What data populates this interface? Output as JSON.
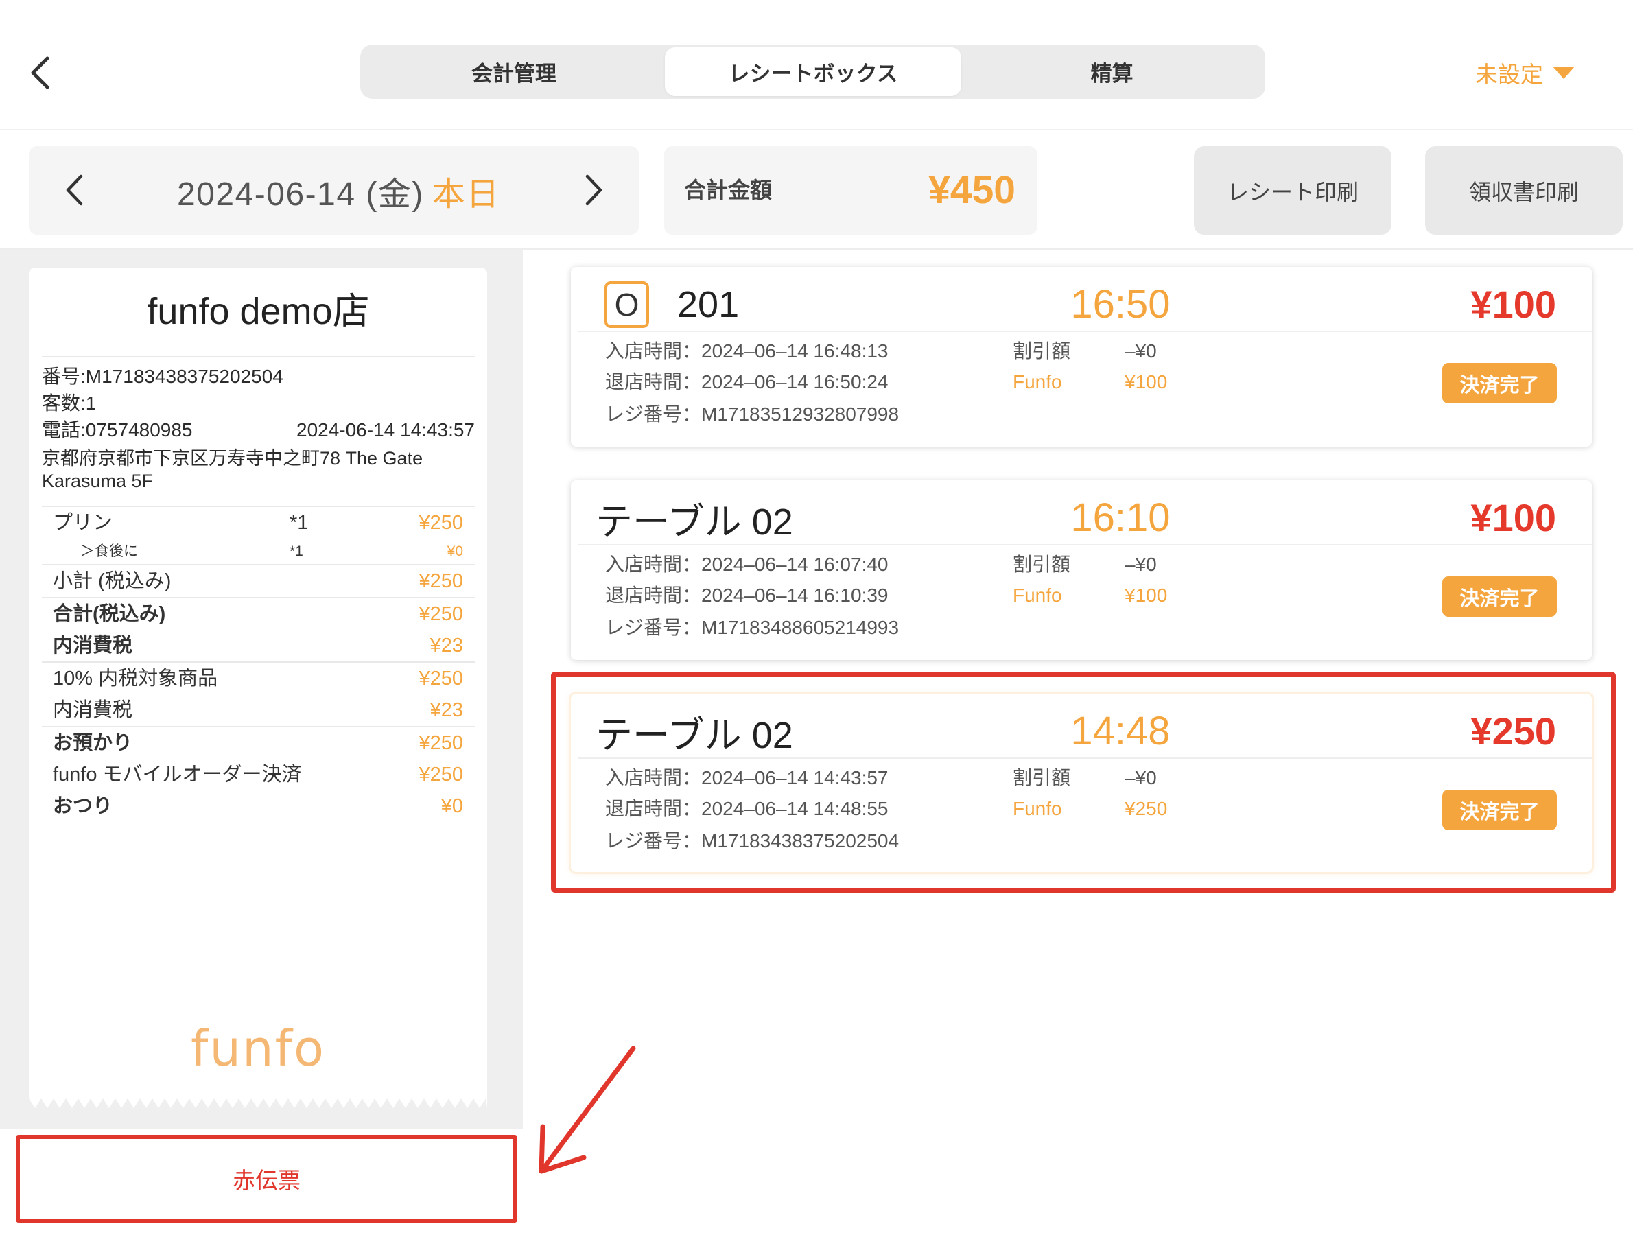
{
  "colors": {
    "accent_orange": "#f5a53d",
    "price_red": "#e5392c",
    "annotation_red": "#e1362c",
    "panel_gray": "#efefef"
  },
  "header": {
    "back_icon": "chevron-left-icon",
    "tabs": [
      {
        "label": "会計管理",
        "active": false
      },
      {
        "label": "レシートボックス",
        "active": true
      },
      {
        "label": "精算",
        "active": false
      }
    ],
    "status_label": "未設定",
    "status_icon": "caret-down-icon"
  },
  "toolbar": {
    "prev_icon": "chevron-left-icon",
    "next_icon": "chevron-right-icon",
    "date": "2024-06-14 (金)",
    "today_label": "本日",
    "total_label": "合計金額",
    "total_value": "¥450",
    "print_receipt_label": "レシート印刷",
    "print_invoice_label": "領収書印刷"
  },
  "receipt": {
    "store_name": "funfo demo店",
    "number": "番号:M17183438375202504",
    "guests": "客数:1",
    "phone": "電話:0757480985",
    "datetime": "2024-06-14 14:43:57",
    "address": [
      "京都府京都市下京区万寿寺中之町78 The Gate",
      "Karasuma 5F"
    ],
    "items": [
      {
        "name": "プリン",
        "qty": "*1",
        "price": "¥250",
        "sub": false
      },
      {
        "name": "＞食後に",
        "qty": "*1",
        "price": "¥0",
        "sub": true
      }
    ],
    "summary_groups": [
      [
        {
          "label": "小計 (税込み)",
          "value": "¥250",
          "strong": false
        }
      ],
      [
        {
          "label": "合計(税込み)",
          "value": "¥250",
          "strong": true
        },
        {
          "label": "内消費税",
          "value": "¥23",
          "strong": true
        }
      ],
      [
        {
          "label": "10% 内税対象商品",
          "value": "¥250",
          "strong": false
        },
        {
          "label": "内消費税",
          "value": "¥23",
          "strong": false
        }
      ],
      [
        {
          "label": "お預かり",
          "value": "¥250",
          "strong": true
        },
        {
          "label": "funfo モバイルオーダー決済",
          "value": "¥250",
          "strong": false
        },
        {
          "label": "おつり",
          "value": "¥0",
          "strong": true
        }
      ]
    ],
    "logo_text": "funfo"
  },
  "red_slip_label": "赤伝票",
  "orders": [
    {
      "icon_letter": "O",
      "title": "201",
      "time": "16:50",
      "amount": "¥100",
      "entry_label": "入店時間：",
      "entry_time": "2024–06–14 16:48:13",
      "exit_label": "退店時間：",
      "exit_time": "2024–06–14 16:50:24",
      "register_label": "レジ番号：",
      "register_no": "M17183512932807998",
      "discount_label": "割引額",
      "discount_value": "–¥0",
      "payment_method": "Funfo",
      "payment_amount": "¥100",
      "status": "決済完了",
      "selected": false
    },
    {
      "title": "テーブル 02",
      "time": "16:10",
      "amount": "¥100",
      "entry_label": "入店時間：",
      "entry_time": "2024–06–14 16:07:40",
      "exit_label": "退店時間：",
      "exit_time": "2024–06–14 16:10:39",
      "register_label": "レジ番号：",
      "register_no": "M17183488605214993",
      "discount_label": "割引額",
      "discount_value": "–¥0",
      "payment_method": "Funfo",
      "payment_amount": "¥100",
      "status": "決済完了",
      "selected": false
    },
    {
      "title": "テーブル 02",
      "time": "14:48",
      "amount": "¥250",
      "entry_label": "入店時間：",
      "entry_time": "2024–06–14 14:43:57",
      "exit_label": "退店時間：",
      "exit_time": "2024–06–14 14:48:55",
      "register_label": "レジ番号：",
      "register_no": "M17183438375202504",
      "discount_label": "割引額",
      "discount_value": "–¥0",
      "payment_method": "Funfo",
      "payment_amount": "¥250",
      "status": "決済完了",
      "selected": true
    }
  ]
}
